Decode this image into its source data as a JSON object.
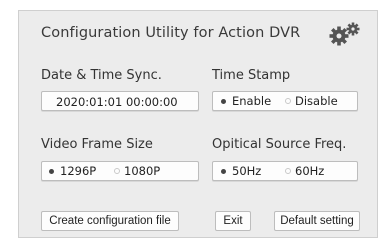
{
  "window": {
    "title": "Configuration Utility for Action DVR",
    "icon": "gears-icon"
  },
  "date_time": {
    "label": "Date & Time Sync.",
    "value": "2020:01:01 00:00:00"
  },
  "time_stamp": {
    "label": "Time Stamp",
    "options": [
      "Enable",
      "Disable"
    ],
    "selected": "Enable"
  },
  "video_frame_size": {
    "label": "Video Frame Size",
    "options": [
      "1296P",
      "1080P"
    ],
    "selected": "1296P"
  },
  "optical_source_freq": {
    "label": "Opitical Source Freq.",
    "options": [
      "50Hz",
      "60Hz"
    ],
    "selected": "50Hz"
  },
  "buttons": {
    "create": "Create configuration file",
    "exit": "Exit",
    "default": "Default setting"
  },
  "colors": {
    "panel_bg": "#ececec",
    "field_bg": "#fdfdfd",
    "border": "#bdbdbd"
  }
}
